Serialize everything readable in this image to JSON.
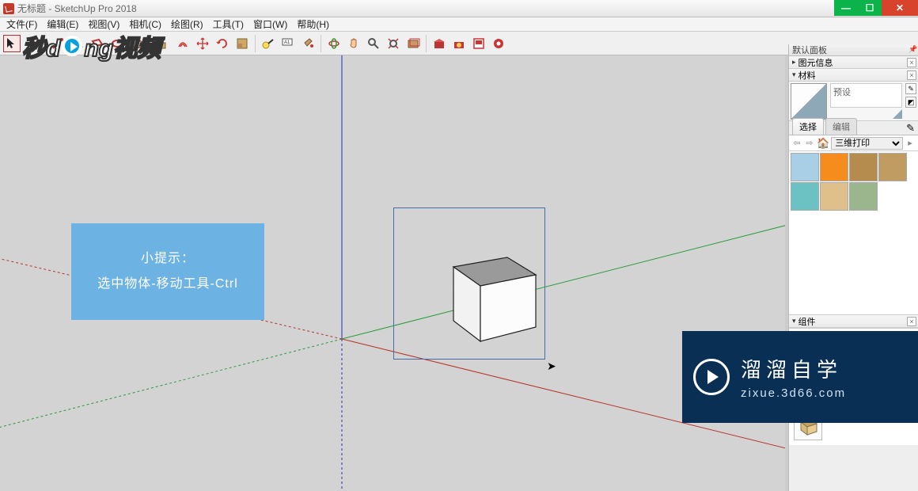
{
  "window": {
    "title": "无标题 - SketchUp Pro 2018"
  },
  "menus": [
    "文件(F)",
    "编辑(E)",
    "视图(V)",
    "相机(C)",
    "绘图(R)",
    "工具(T)",
    "窗口(W)",
    "帮助(H)"
  ],
  "toolbar_icons": [
    "select",
    "eraser",
    "line",
    "arc",
    "rectangle",
    "circle",
    "polygon",
    "push-pull",
    "offset",
    "move",
    "rotate",
    "scale",
    "tape",
    "text",
    "paint",
    "orbit",
    "pan",
    "zoom",
    "zoom-extents",
    "walk",
    "warehouse",
    "3d-ware",
    "layers",
    "ruby"
  ],
  "tip": {
    "title": "小提示：",
    "body": "选中物体-移动工具-Ctrl"
  },
  "right": {
    "default_tray": "默认面板",
    "entity_info": "图元信息",
    "materials": "材料",
    "preset_label": "预设",
    "tabs": {
      "select": "选择",
      "edit": "编辑"
    },
    "dropdown": "三维打印",
    "swatch_colors": [
      "#a9cfe7",
      "#f58c1b",
      "#b68b4e",
      "#c09b62",
      "#6cc2c2",
      "#e0c08a",
      "#9bb58d"
    ],
    "components": "组件"
  },
  "wm_top": {
    "a": "秒d",
    "b": "ng视频"
  },
  "wm_bottom": {
    "t1": "溜溜自学",
    "t2": "zixue.3d66.com"
  }
}
